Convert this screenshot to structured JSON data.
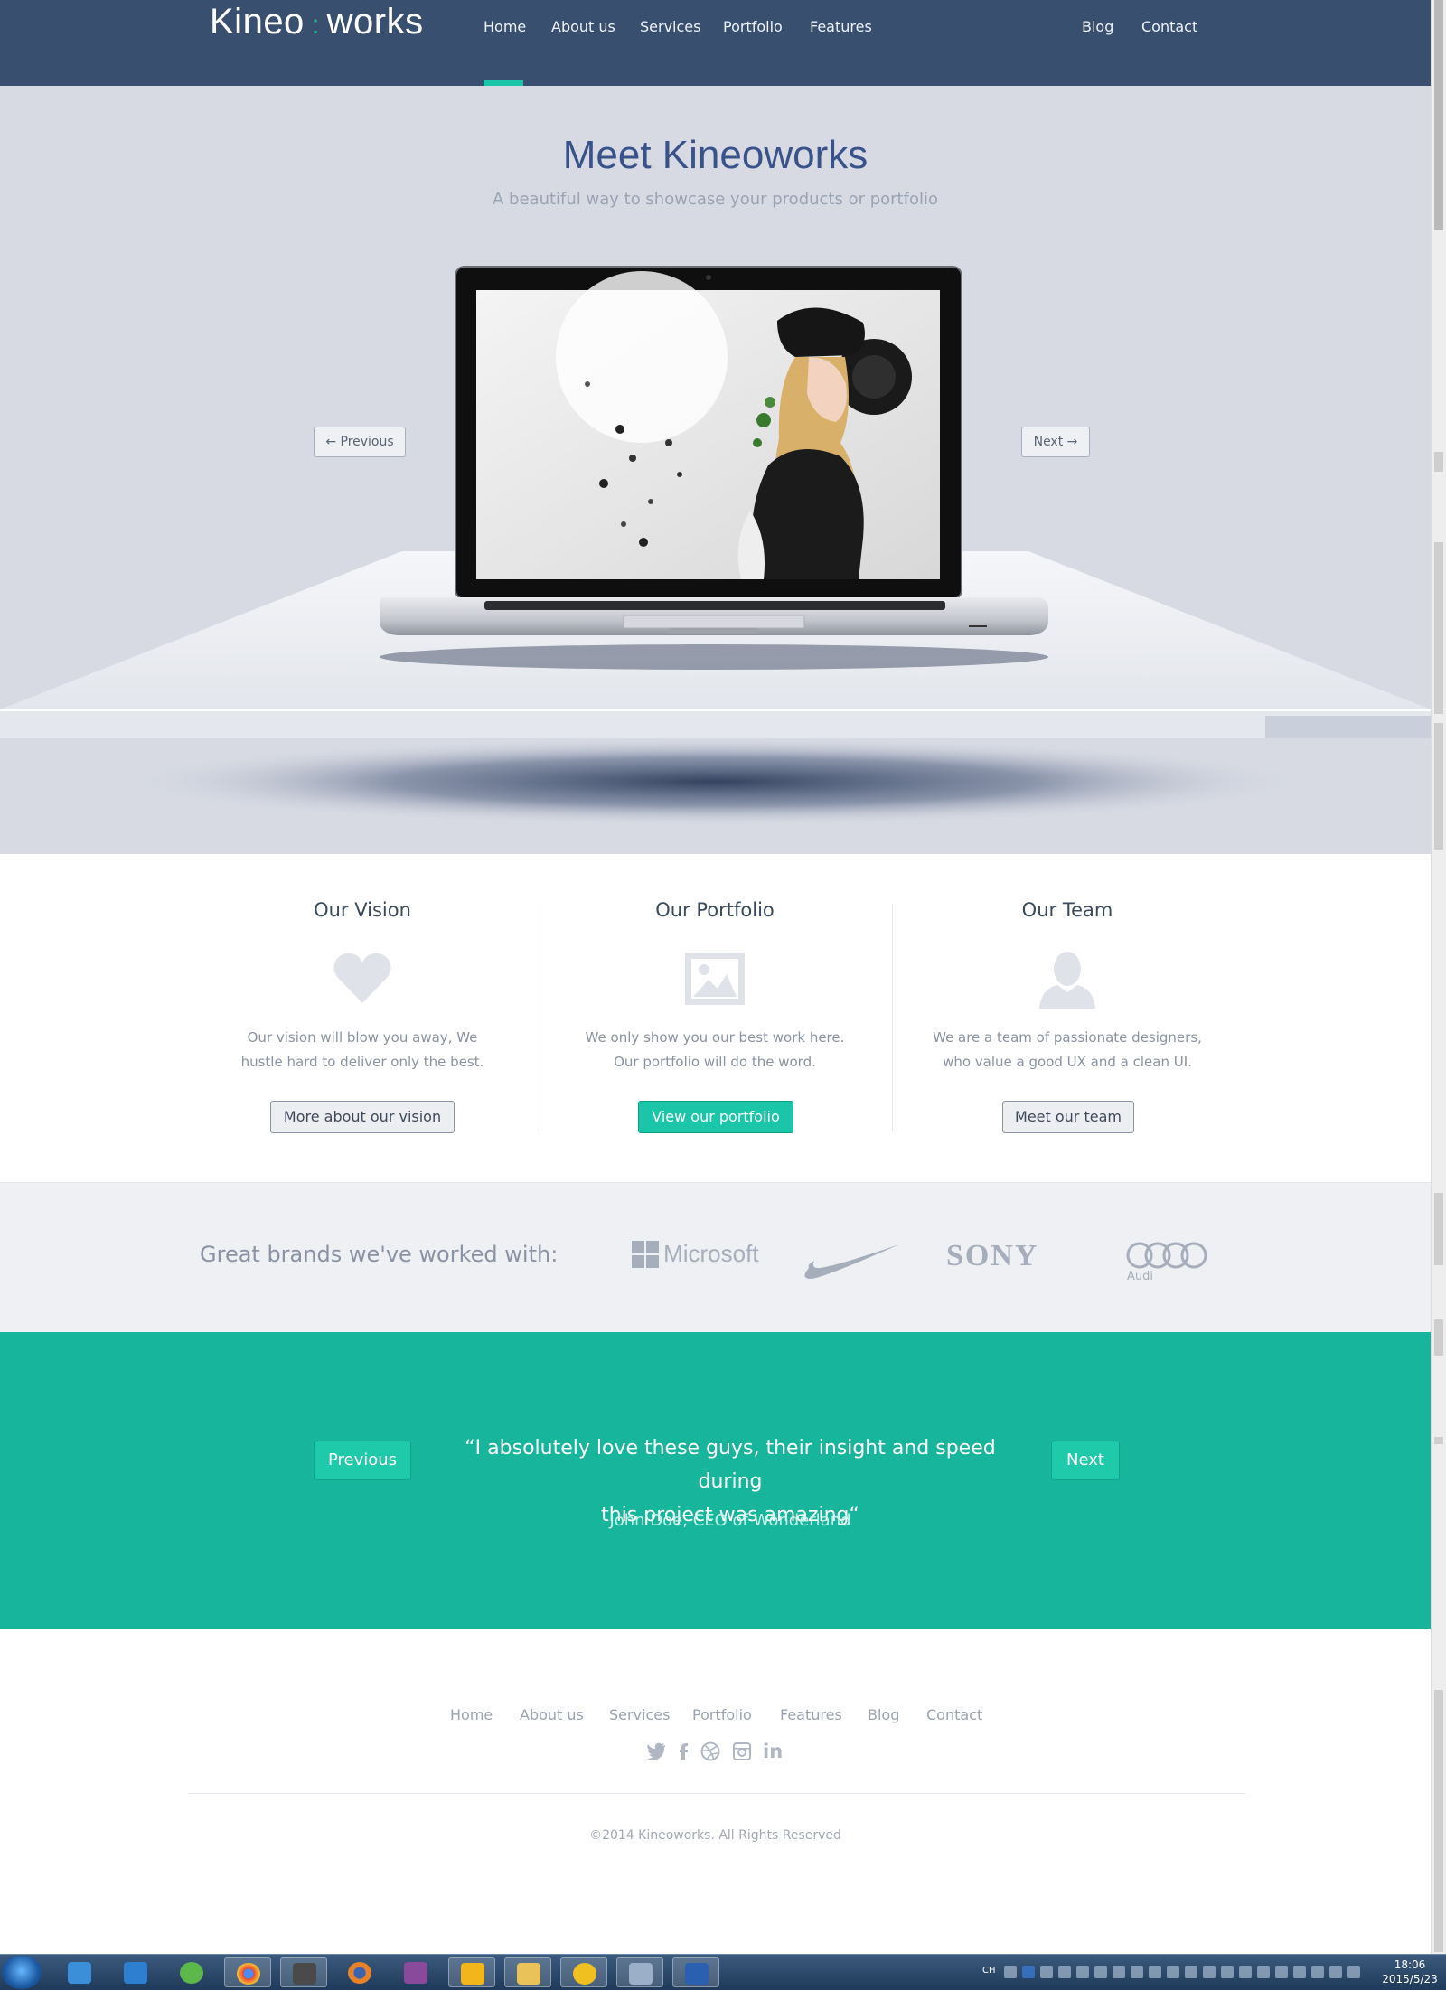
{
  "nav": {
    "logo_left": "Kineo",
    "logo_sep": ":",
    "logo_right": "works",
    "links": [
      "Home",
      "About us",
      "Services",
      "Portfolio",
      "Features",
      "Blog",
      "Contact"
    ],
    "active": "Home"
  },
  "hero": {
    "title": "Meet Kineoworks",
    "subtitle": "A beautiful way to showcase your products or portfolio",
    "prev_label": "← Previous",
    "next_label": "Next →"
  },
  "features": [
    {
      "title": "Our Vision",
      "icon": "heart-icon",
      "text1": "Our vision will blow you away, We",
      "text2": "hustle hard to deliver only the best.",
      "button": "More about our vision"
    },
    {
      "title": "Our Portfolio",
      "icon": "image-icon",
      "text1": "We only show you our best work here.",
      "text2": "Our portfolio will do the word.",
      "button": "View our portfolio"
    },
    {
      "title": "Our Team",
      "icon": "user-icon",
      "text1": "We are a team of passionate designers,",
      "text2": "who value a good UX and a clean UI.",
      "button": "Meet our team"
    }
  ],
  "brands": {
    "label": "Great brands we've worked with:",
    "logos": [
      "Microsoft",
      "Nike",
      "SONY",
      "Audi"
    ]
  },
  "testimonial": {
    "quote_line1": "“I absolutely love these guys, their insight and speed during",
    "quote_line2": "this project was amazing“",
    "author": "John Doe, CEO of Wonderland",
    "prev_label": "Previous",
    "next_label": "Next"
  },
  "footer": {
    "links": [
      "Home",
      "About us",
      "Services",
      "Portfolio",
      "Features",
      "Blog",
      "Contact"
    ],
    "social": [
      "twitter-icon",
      "facebook-icon",
      "dribbble-icon",
      "instagram-icon",
      "linkedin-icon"
    ],
    "linkedin_text": "in",
    "copyright": "©2014 Kineoworks. All Rights Reserved"
  },
  "taskbar": {
    "apps": [
      "internet-explorer-icon",
      "qq-browser-icon",
      "360-icon",
      "chrome-icon",
      "sublime-text-icon",
      "firefox-icon",
      "game-icon",
      "star-icon",
      "file-explorer-icon",
      "music-player-icon",
      "photo-viewer-icon",
      "word-icon"
    ],
    "tray_lang": "CH",
    "time": "18:06",
    "date": "2015/5/23"
  },
  "colors": {
    "nav_bg": "#384f70",
    "accent": "#1bc6a8",
    "hero_bg": "#d7dae3",
    "testimonial_bg": "#16b59c"
  }
}
